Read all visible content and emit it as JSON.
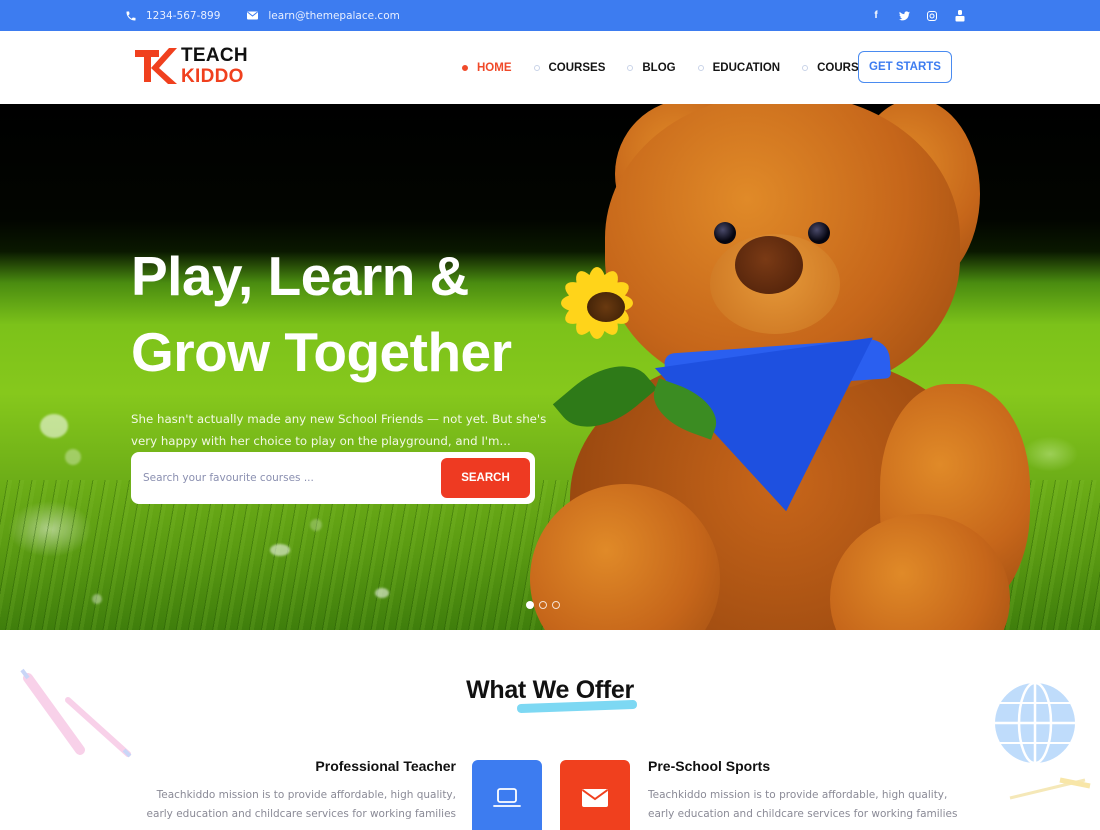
{
  "topbar": {
    "phone": "1234-567-899",
    "email": "learn@themepalace.com",
    "social": [
      {
        "name": "facebook",
        "glyph": "f"
      },
      {
        "name": "twitter",
        "glyph": "t"
      },
      {
        "name": "instagram",
        "glyph": "◎"
      },
      {
        "name": "youtube",
        "glyph": "▶"
      }
    ]
  },
  "brand": {
    "line1": "TEACH",
    "line2": "KIDDO",
    "accent": "#f0401e"
  },
  "nav": {
    "items": [
      {
        "label": "HOME",
        "active": true
      },
      {
        "label": "COURSES",
        "active": false
      },
      {
        "label": "BLOG",
        "active": false
      },
      {
        "label": "EDUCATION",
        "active": false
      },
      {
        "label": "COURSES",
        "active": false
      }
    ],
    "cta_label": "GET STARTS"
  },
  "hero": {
    "title_line1": "Play, Learn &",
    "title_line2": "Grow Together",
    "description": "She hasn't actually made any new School Friends — not yet. But she's very happy with her choice to play on the playground, and I'm...",
    "search": {
      "placeholder": "Search your favourite courses ...",
      "value": "",
      "button_label": "SEARCH"
    },
    "slider": {
      "total": 3,
      "active_index": 0
    }
  },
  "offer": {
    "title": "What We Offer",
    "cards": [
      {
        "title": "Professional Teacher",
        "description": "Teachkiddo mission is to provide affordable, high quality, early education and childcare services for working families",
        "icon": "laptop-icon",
        "color": "#3d7cf0"
      },
      {
        "title": "Pre-School Sports",
        "description": "Teachkiddo mission is to provide affordable, high quality, early education and childcare services for working families",
        "icon": "envelope-icon",
        "color": "#f0401e"
      }
    ]
  },
  "colors": {
    "primary_blue": "#3d7cf0",
    "accent_red": "#f0401e",
    "highlight_cyan": "#6fd4f2"
  }
}
